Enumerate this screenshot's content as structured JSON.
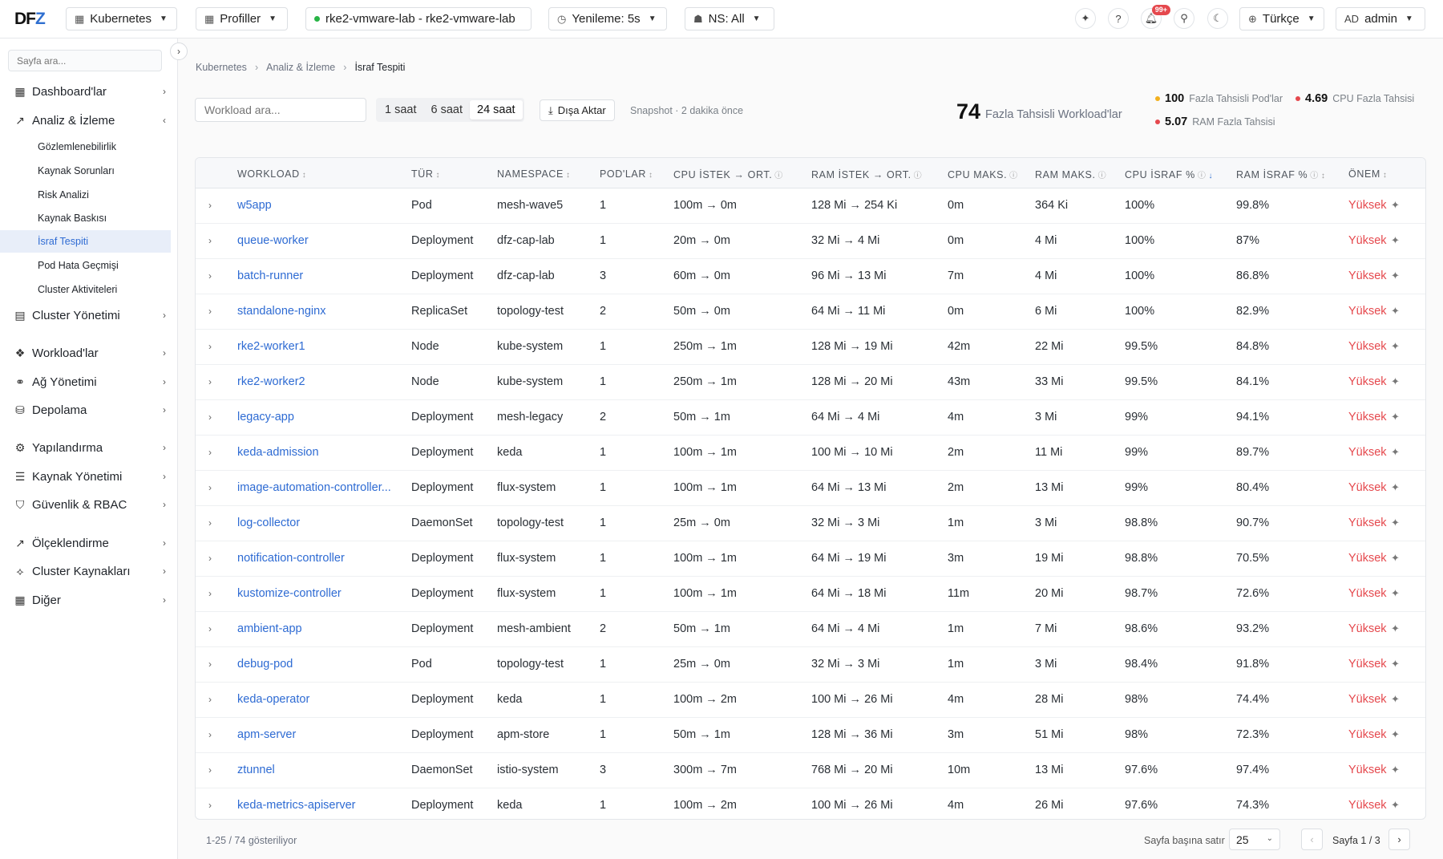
{
  "header": {
    "logo": "DFZ",
    "kubernetes": "Kubernetes",
    "profiles": "Profiller",
    "cluster": "rke2-vmware-lab - rke2-vmware-lab",
    "refresh": "Yenileme: 5s",
    "namespace": "NS: All",
    "notif_badge": "99+",
    "help": "?",
    "language": "Türkçe",
    "user_initials": "AD",
    "user_name": "admin"
  },
  "sidebar": {
    "search_placeholder": "Sayfa ara...",
    "items": [
      {
        "label": "Dashboard'lar",
        "icon": "grid-icon"
      },
      {
        "label": "Analiz & İzleme",
        "icon": "chart-icon"
      },
      {
        "label": "Cluster Yönetimi",
        "icon": "server-icon"
      },
      {
        "label": "Workload'lar",
        "icon": "cubes-icon"
      },
      {
        "label": "Ağ Yönetimi",
        "icon": "network-icon"
      },
      {
        "label": "Depolama",
        "icon": "database-icon"
      },
      {
        "label": "Yapılandırma",
        "icon": "gear-icon"
      },
      {
        "label": "Kaynak Yönetimi",
        "icon": "list-icon"
      },
      {
        "label": "Güvenlik & RBAC",
        "icon": "shield-icon"
      },
      {
        "label": "Ölçeklendirme",
        "icon": "trend-icon"
      },
      {
        "label": "Cluster Kaynakları",
        "icon": "nodes-icon"
      },
      {
        "label": "Diğer",
        "icon": "grid-icon"
      }
    ],
    "sub_items": [
      "Gözlemlenebilirlik",
      "Kaynak Sorunları",
      "Risk Analizi",
      "Kaynak Baskısı",
      "İsraf Tespiti",
      "Pod Hata Geçmişi",
      "Cluster Aktiviteleri"
    ]
  },
  "breadcrumb": [
    "Kubernetes",
    "Analiz & İzleme",
    "İsraf Tespiti"
  ],
  "toolbar": {
    "search_placeholder": "Workload ara...",
    "ranges": [
      "1 saat",
      "6 saat",
      "24 saat"
    ],
    "active_range": "24 saat",
    "export": "Dışa Aktar",
    "snapshot": "Snapshot · 2 dakika önce"
  },
  "summary": {
    "count": "74",
    "label": "Fazla Tahsisli Workload'lar",
    "stats": [
      {
        "value": "100",
        "label": "Fazla Tahsisli Pod'lar",
        "color": "#f2b01e"
      },
      {
        "value": "4.69",
        "label": "CPU Fazla Tahsisi",
        "color": "#e5484d"
      },
      {
        "value": "5.07",
        "label": "RAM Fazla Tahsisi",
        "color": "#e5484d"
      }
    ]
  },
  "table": {
    "headers": [
      "WORKLOAD",
      "TÜR",
      "NAMESPACE",
      "POD'LAR",
      "CPU İSTEK → ORT.",
      "RAM İSTEK → ORT.",
      "CPU MAKS.",
      "RAM MAKS.",
      "CPU İSRAF %",
      "RAM İSRAF %",
      "ÖNEM"
    ],
    "rows": [
      [
        "w5app",
        "Pod",
        "mesh-wave5",
        "1",
        "100m → 0m",
        "128 Mi → 254 Ki",
        "0m",
        "364 Ki",
        "100%",
        "99.8%",
        "Yüksek"
      ],
      [
        "queue-worker",
        "Deployment",
        "dfz-cap-lab",
        "1",
        "20m → 0m",
        "32 Mi → 4 Mi",
        "0m",
        "4 Mi",
        "100%",
        "87%",
        "Yüksek"
      ],
      [
        "batch-runner",
        "Deployment",
        "dfz-cap-lab",
        "3",
        "60m → 0m",
        "96 Mi → 13 Mi",
        "7m",
        "4 Mi",
        "100%",
        "86.8%",
        "Yüksek"
      ],
      [
        "standalone-nginx",
        "ReplicaSet",
        "topology-test",
        "2",
        "50m → 0m",
        "64 Mi → 11 Mi",
        "0m",
        "6 Mi",
        "100%",
        "82.9%",
        "Yüksek"
      ],
      [
        "rke2-worker1",
        "Node",
        "kube-system",
        "1",
        "250m → 1m",
        "128 Mi → 19 Mi",
        "42m",
        "22 Mi",
        "99.5%",
        "84.8%",
        "Yüksek"
      ],
      [
        "rke2-worker2",
        "Node",
        "kube-system",
        "1",
        "250m → 1m",
        "128 Mi → 20 Mi",
        "43m",
        "33 Mi",
        "99.5%",
        "84.1%",
        "Yüksek"
      ],
      [
        "legacy-app",
        "Deployment",
        "mesh-legacy",
        "2",
        "50m → 1m",
        "64 Mi → 4 Mi",
        "4m",
        "3 Mi",
        "99%",
        "94.1%",
        "Yüksek"
      ],
      [
        "keda-admission",
        "Deployment",
        "keda",
        "1",
        "100m → 1m",
        "100 Mi → 10 Mi",
        "2m",
        "11 Mi",
        "99%",
        "89.7%",
        "Yüksek"
      ],
      [
        "image-automation-controller...",
        "Deployment",
        "flux-system",
        "1",
        "100m → 1m",
        "64 Mi → 13 Mi",
        "2m",
        "13 Mi",
        "99%",
        "80.4%",
        "Yüksek"
      ],
      [
        "log-collector",
        "DaemonSet",
        "topology-test",
        "1",
        "25m → 0m",
        "32 Mi → 3 Mi",
        "1m",
        "3 Mi",
        "98.8%",
        "90.7%",
        "Yüksek"
      ],
      [
        "notification-controller",
        "Deployment",
        "flux-system",
        "1",
        "100m → 1m",
        "64 Mi → 19 Mi",
        "3m",
        "19 Mi",
        "98.8%",
        "70.5%",
        "Yüksek"
      ],
      [
        "kustomize-controller",
        "Deployment",
        "flux-system",
        "1",
        "100m → 1m",
        "64 Mi → 18 Mi",
        "11m",
        "20 Mi",
        "98.7%",
        "72.6%",
        "Yüksek"
      ],
      [
        "ambient-app",
        "Deployment",
        "mesh-ambient",
        "2",
        "50m → 1m",
        "64 Mi → 4 Mi",
        "1m",
        "7 Mi",
        "98.6%",
        "93.2%",
        "Yüksek"
      ],
      [
        "debug-pod",
        "Pod",
        "topology-test",
        "1",
        "25m → 0m",
        "32 Mi → 3 Mi",
        "1m",
        "3 Mi",
        "98.4%",
        "91.8%",
        "Yüksek"
      ],
      [
        "keda-operator",
        "Deployment",
        "keda",
        "1",
        "100m → 2m",
        "100 Mi → 26 Mi",
        "4m",
        "28 Mi",
        "98%",
        "74.4%",
        "Yüksek"
      ],
      [
        "apm-server",
        "Deployment",
        "apm-store",
        "1",
        "50m → 1m",
        "128 Mi → 36 Mi",
        "3m",
        "51 Mi",
        "98%",
        "72.3%",
        "Yüksek"
      ],
      [
        "ztunnel",
        "DaemonSet",
        "istio-system",
        "3",
        "300m → 7m",
        "768 Mi → 20 Mi",
        "10m",
        "13 Mi",
        "97.6%",
        "97.4%",
        "Yüksek"
      ],
      [
        "keda-metrics-apiserver",
        "Deployment",
        "keda",
        "1",
        "100m → 2m",
        "100 Mi → 26 Mi",
        "4m",
        "26 Mi",
        "97.6%",
        "74.3%",
        "Yüksek"
      ]
    ]
  },
  "footer": {
    "showing": "1-25 / 74 gösteriliyor",
    "per_page_label": "Sayfa başına satır",
    "per_page": "25",
    "page": "Sayfa 1 / 3"
  },
  "colors": {
    "accent": "#2e6bd3",
    "severity_high": "#e5484d"
  }
}
